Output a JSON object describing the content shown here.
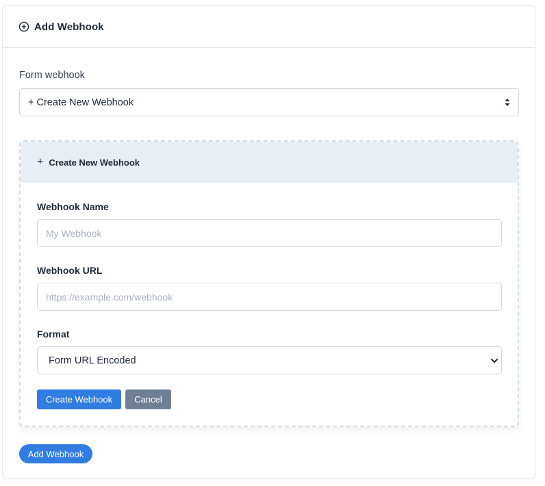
{
  "header": {
    "icon": "plus-circle-icon",
    "title": "Add Webhook"
  },
  "form": {
    "webhook_label": "Form webhook",
    "webhook_select_value": "+ Create New Webhook"
  },
  "create_panel": {
    "icon": "plus-icon",
    "title": "Create New Webhook",
    "name_label": "Webhook Name",
    "name_placeholder": "My Webhook",
    "name_value": "",
    "url_label": "Webhook URL",
    "url_placeholder": "https://example.com/webhook",
    "url_value": "",
    "format_label": "Format",
    "format_value": "Form URL Encoded",
    "create_button": "Create Webhook",
    "cancel_button": "Cancel"
  },
  "footer": {
    "add_button": "Add Webhook"
  },
  "colors": {
    "primary": "#2f7de1",
    "secondary": "#6f7f96",
    "panel_header_bg": "#e9eef5",
    "border": "#d1d5db"
  }
}
